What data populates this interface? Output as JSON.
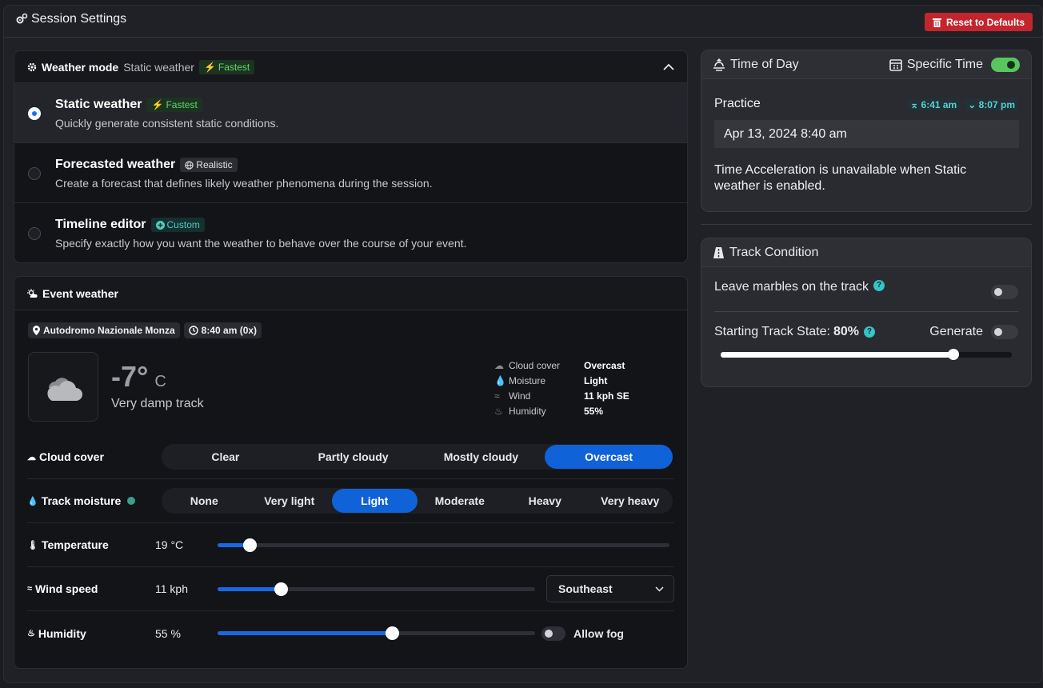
{
  "header": {
    "title": "Session Settings",
    "reset_label": "Reset to Defaults"
  },
  "weather_mode": {
    "title": "Weather mode",
    "current": "Static weather",
    "current_badge": "Fastest",
    "options": [
      {
        "title": "Static weather",
        "badge": "Fastest",
        "desc": "Quickly generate consistent static conditions.",
        "selected": true
      },
      {
        "title": "Forecasted weather",
        "badge": "Realistic",
        "desc": "Create a forecast that defines likely weather phenomena during the session.",
        "selected": false
      },
      {
        "title": "Timeline editor",
        "badge": "Custom",
        "desc": "Specify exactly how you want the weather to behave over the course of your event.",
        "selected": false
      }
    ]
  },
  "event_weather": {
    "title": "Event weather",
    "track_chip": "Autodromo Nazionale Monza",
    "time_chip": "8:40 am (0x)",
    "temp_value": "-7°",
    "temp_unit": "C",
    "track_state": "Very damp track",
    "summary": [
      {
        "label": "Cloud cover",
        "value": "Overcast",
        "icon": "cloud-icon"
      },
      {
        "label": "Moisture",
        "value": "Light",
        "icon": "moisture-icon"
      },
      {
        "label": "Wind",
        "value": "11 kph SE",
        "icon": "wind-icon"
      },
      {
        "label": "Humidity",
        "value": "55%",
        "icon": "humidity-icon"
      }
    ],
    "cloud_cover": {
      "label": "Cloud cover",
      "options": [
        "Clear",
        "Partly cloudy",
        "Mostly cloudy",
        "Overcast"
      ],
      "selected": "Overcast"
    },
    "track_moisture": {
      "label": "Track moisture",
      "options": [
        "None",
        "Very light",
        "Light",
        "Moderate",
        "Heavy",
        "Very heavy"
      ],
      "selected": "Light"
    },
    "temperature": {
      "label": "Temperature",
      "value": "19 °C",
      "level": 0.07
    },
    "wind_speed": {
      "label": "Wind speed",
      "value": "11 kph",
      "level": 0.2,
      "direction": "Southeast"
    },
    "humidity": {
      "label": "Humidity",
      "value": "55 %",
      "level": 0.55,
      "fog_label": "Allow fog",
      "fog_on": false
    }
  },
  "time_of_day": {
    "title": "Time of Day",
    "specific_time_label": "Specific Time",
    "specific_time_on": true,
    "session": "Practice",
    "sunrise": "6:41 am",
    "sunset": "8:07 pm",
    "datetime": "Apr 13, 2024 8:40 am",
    "note": "Time Acceleration is unavailable when Static weather is enabled."
  },
  "track_condition": {
    "title": "Track Condition",
    "marbles_label": "Leave marbles on the track",
    "marbles_on": false,
    "state_label": "Starting Track State:",
    "state_value": "80%",
    "state_level": 0.8,
    "generate_label": "Generate",
    "generate_on": false
  },
  "colors": {
    "accent": "#0f62d8",
    "danger": "#c2262c",
    "success": "#58c55e",
    "teal": "#37c4c4"
  }
}
